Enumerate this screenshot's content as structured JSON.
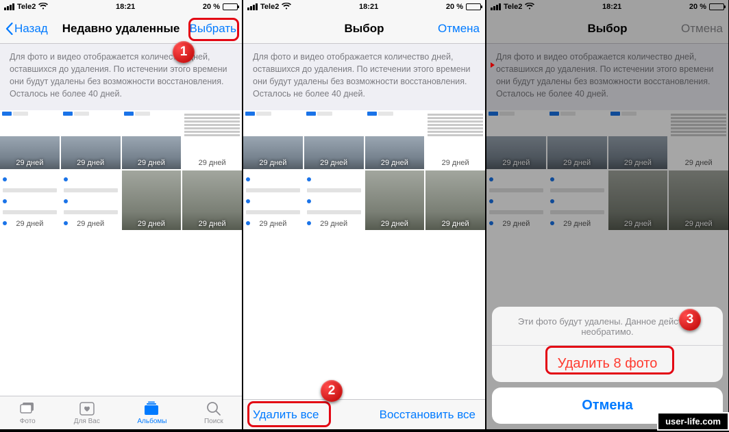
{
  "status": {
    "carrier": "Tele2",
    "time": "18:21",
    "battery_pct": "20 %"
  },
  "screen1": {
    "back": "Назад",
    "title": "Недавно удаленные",
    "select": "Выбрать",
    "info": "Для фото и видео отображается количество дней, оставшихся до удаления. По истечении этого времени они будут удалены без возможности восстановления. Осталось не более 40 дней.",
    "days": [
      "29 дней",
      "29 дней",
      "29 дней",
      "29 дней",
      "29 дней",
      "29 дней",
      "29 дней",
      "29 дней"
    ],
    "tabs": {
      "photo": "Фото",
      "for_you": "Для Вас",
      "albums": "Альбомы",
      "search": "Поиск"
    },
    "callout": "1"
  },
  "screen2": {
    "title": "Выбор",
    "cancel": "Отмена",
    "info": "Для фото и видео отображается количество дней, оставшихся до удаления. По истечении этого времени они будут удалены без возможности восстановления. Осталось не более 40 дней.",
    "days": [
      "29 дней",
      "29 дней",
      "29 дней",
      "29 дней",
      "29 дней",
      "29 дней",
      "29 дней",
      "29 дней"
    ],
    "delete_all": "Удалить все",
    "recover_all": "Восстановить все",
    "callout": "2"
  },
  "screen3": {
    "title": "Выбор",
    "cancel_nav": "Отмена",
    "info": "Для фото и видео отображается количество дней, оставшихся до удаления. По истечении этого времени они будут удалены без возможности восстановления. Осталось не более 40 дней.",
    "days": [
      "29 дней",
      "29 дней",
      "29 дней",
      "29 дней",
      "29 дней",
      "29 дней",
      "29 дней",
      "29 дней"
    ],
    "sheet_msg": "Эти фото будут удалены. Данное действие необратимо.",
    "sheet_delete": "Удалить 8 фото",
    "sheet_cancel": "Отмена",
    "callout": "3"
  },
  "watermark": "user-life.com"
}
